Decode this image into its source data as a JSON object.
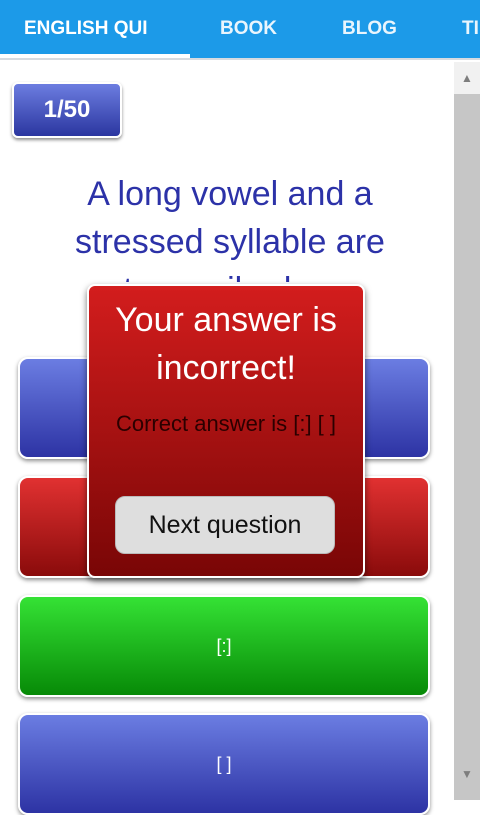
{
  "nav": {
    "tabs": [
      {
        "label": "ENGLISH QUI"
      },
      {
        "label": "BOOK"
      },
      {
        "label": "BLOG"
      },
      {
        "label": "TI"
      }
    ]
  },
  "quiz": {
    "counter": "1/50",
    "question_line1": "A long vowel and a",
    "question_line2": "stressed syllable are",
    "question_line3": "transcribed as",
    "answers": [
      {
        "label": ""
      },
      {
        "label": ""
      },
      {
        "label": "[:]"
      },
      {
        "label": "[ ]"
      }
    ]
  },
  "popup": {
    "title": "Your answer is incorrect!",
    "message": "Correct answer is [:] [ ]",
    "next_label": "Next question"
  },
  "colors": {
    "nav": "#1c9ae8",
    "blue_button": "#3a45b3",
    "red_button": "#b81818",
    "green_button": "#1cb81c"
  }
}
